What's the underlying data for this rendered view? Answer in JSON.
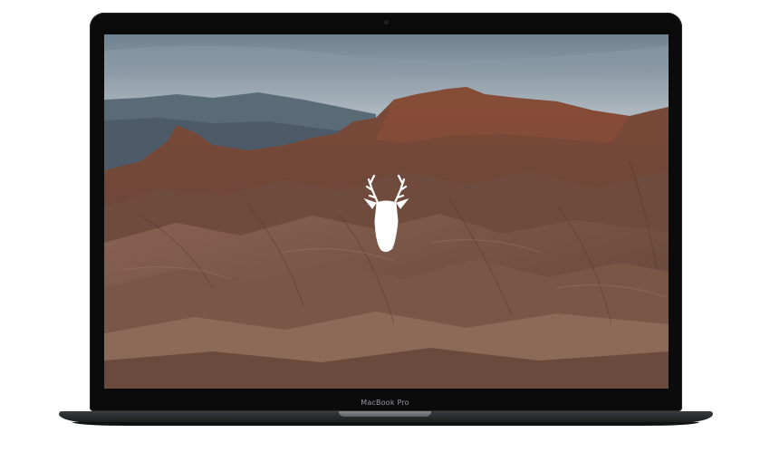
{
  "device": {
    "label": "MacBook Pro"
  },
  "wallpaper": {
    "description_icon": "deer-head-icon",
    "colors": {
      "sky_top": "#7d8f9c",
      "sky_bottom": "#c9ced2",
      "far_mountains": "#5b6c79",
      "rock_dark": "#4a2f26",
      "rock_mid": "#7a5242",
      "rock_light": "#a88572",
      "logo": "#ffffff"
    }
  }
}
